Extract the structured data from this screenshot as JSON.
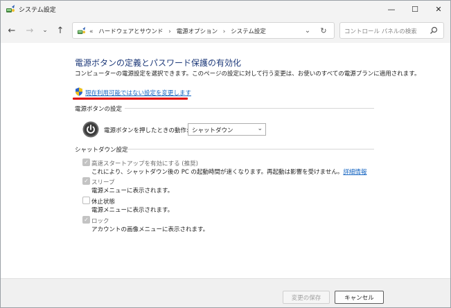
{
  "window": {
    "title": "システム設定",
    "minimize": "—",
    "maximize": "☐",
    "close": "✕"
  },
  "nav": {
    "breadcrumb": [
      "ハードウェアとサウンド",
      "電源オプション",
      "システム設定"
    ],
    "breadcrumb_prefix": "«",
    "breadcrumb_sep": "›",
    "search_placeholder": "コントロール パネルの検索"
  },
  "page": {
    "title": "電源ボタンの定義とパスワード保護の有効化",
    "description": "コンピューターの電源設定を選択できます。このページの設定に対して行う変更は、お使いのすべての電源プランに適用されます。",
    "change_link": "現在利用可能ではない設定を変更します"
  },
  "power_section": {
    "heading": "電源ボタンの設定",
    "field_label": "電源ボタンを押したときの動作:",
    "selected": "シャットダウン"
  },
  "shutdown_section": {
    "heading": "シャットダウン設定",
    "options": [
      {
        "label": "高速スタートアップを有効にする (推奨)",
        "desc": "これにより、シャットダウン後の PC の起動時間が速くなります。再起動は影響を受けません。",
        "link": "詳細情報",
        "checked": true,
        "disabled": true
      },
      {
        "label": "スリープ",
        "desc": "電源メニューに表示されます。",
        "checked": true,
        "disabled": true
      },
      {
        "label": "休止状態",
        "desc": "電源メニューに表示されます。",
        "checked": false,
        "disabled": false
      },
      {
        "label": "ロック",
        "desc": "アカウントの画像メニューに表示されます。",
        "checked": true,
        "disabled": true
      }
    ]
  },
  "footer": {
    "save_label": "変更の保存",
    "cancel_label": "キャンセル"
  },
  "colors": {
    "title_blue": "#1e3a7a",
    "link_blue": "#1665c1",
    "highlight_red": "#e00000"
  }
}
